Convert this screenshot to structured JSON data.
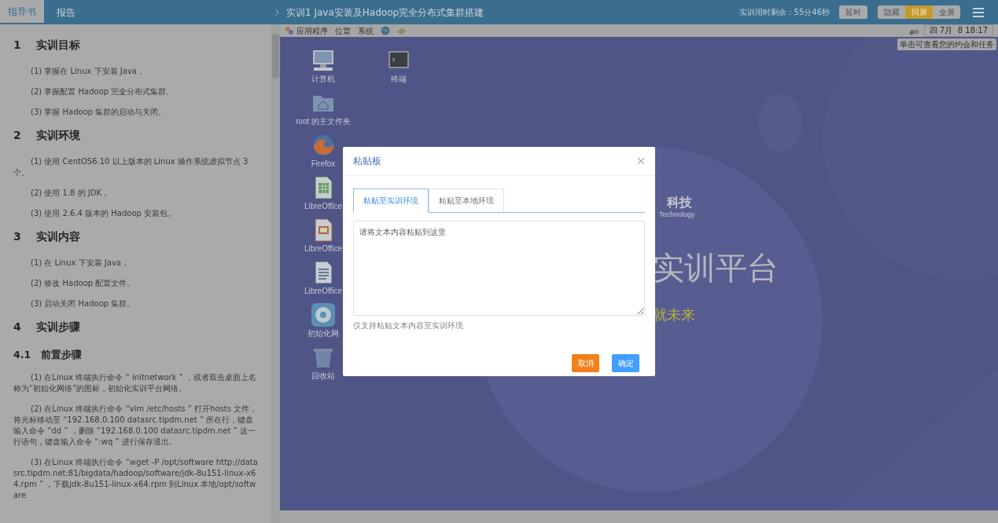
{
  "header": {
    "tabs": [
      {
        "label": "指导书",
        "selected": true
      },
      {
        "label": "报告",
        "selected": false
      }
    ],
    "title": "实训1 Java安装及Hadoop完全分布式集群搭建",
    "timer": "实训用时剩余：55分46秒",
    "extend_button": "延时",
    "view_buttons": [
      {
        "label": "隐藏",
        "selected": false
      },
      {
        "label": "同屏",
        "selected": true
      },
      {
        "label": "全屏",
        "selected": false
      }
    ]
  },
  "guide": {
    "blocks": [
      {
        "kind": "h1",
        "number": "1",
        "text": "实训目标"
      },
      {
        "kind": "p",
        "text": "(1)  掌握在 Linux 下安装 Java 。"
      },
      {
        "kind": "p",
        "text": "(2)  掌握配置 Hadoop 完全分布式集群。"
      },
      {
        "kind": "p",
        "text": "(3)  掌握 Hadoop 集群的启动与关闭。"
      },
      {
        "kind": "h1",
        "number": "2",
        "text": "实训环境"
      },
      {
        "kind": "p",
        "text": "(1)  使用 CentOS6.10 以上版本的 Linux 操作系统虚拟节点 3 个。"
      },
      {
        "kind": "p",
        "text": "(2)  使用 1.8 的 JDK 。"
      },
      {
        "kind": "p",
        "text": "(3)  使用 2.6.4 版本的 Hadoop 安装包。"
      },
      {
        "kind": "h1",
        "number": "3",
        "text": "实训内容"
      },
      {
        "kind": "p",
        "text": "(1)  在 Linux 下安装 Java 。"
      },
      {
        "kind": "p",
        "text": "(2)  修改 Hadoop 配置文件。"
      },
      {
        "kind": "p",
        "text": "(3)  启动关闭 Hadoop 集群。"
      },
      {
        "kind": "h1",
        "number": "4",
        "text": "实训步骤"
      },
      {
        "kind": "h2",
        "number": "4.1",
        "text": "前置步骤"
      },
      {
        "kind": "p",
        "text": "(1)  在Linux 终端执行命令 “ initnetwork ” ，或者双击桌面上名称为“初始化网络”的图标，初始化实训平台网络。"
      },
      {
        "kind": "p",
        "text": "(2)  在Linux 终端执行命令 “vim /etc/hosts ” 打开hosts 文件，将光标移动至 “192.168.0.100 datasrc.tipdm.net ” 所在行，键盘输入命令 “dd ” ，删除 “192.168.0.100 datasrc.tipdm.net ” 这一行语句，键盘输入命令 “:wq ” 进行保存退出。"
      },
      {
        "kind": "p",
        "text": "(3)  在Linux 终端执行命令 “wget -P /opt/software http://datasrc.tipdm.net:81/bigdata/hadoop/software/jdk-8u151-linux-x64.rpm ” ，下载jdk-8u151-linux-x64.rpm 到Linux 本地/opt/software"
      }
    ]
  },
  "vm": {
    "menu": [
      "应用程序",
      "位置",
      "系统"
    ],
    "clock": "四 7月  8 18:17",
    "tooltip": "单击可查看您的约会和任务",
    "icons_col1": [
      {
        "kind": "computer",
        "label": "计算机"
      },
      {
        "kind": "folder",
        "label": "root 的主文件夹"
      },
      {
        "kind": "browser",
        "label": "Firefox"
      },
      {
        "kind": "spreadsheet",
        "label": "LibreOffice"
      },
      {
        "kind": "presentation",
        "label": "LibreOffice"
      },
      {
        "kind": "document",
        "label": "LibreOffice"
      },
      {
        "kind": "network",
        "label": "初始化网"
      },
      {
        "kind": "trash",
        "label": "回收站"
      }
    ],
    "icons_col2": [
      {
        "kind": "terminal",
        "label": "终端"
      }
    ],
    "wallpaper": {
      "brand": "科技",
      "brand_sub": "Technology",
      "headline": "实训平台",
      "slogan": "就未来"
    }
  },
  "dialog": {
    "title": "粘贴板",
    "tabs": [
      {
        "label": "粘贴至实训环境",
        "selected": true
      },
      {
        "label": "粘贴至本地环境",
        "selected": false
      }
    ],
    "placeholder": "请将文本内容粘贴到这里",
    "hint": "仅支持粘贴文本内容至实训环境",
    "buttons": [
      {
        "kind": "cancel",
        "label": "取消"
      },
      {
        "kind": "confirm",
        "label": "确定"
      }
    ]
  }
}
